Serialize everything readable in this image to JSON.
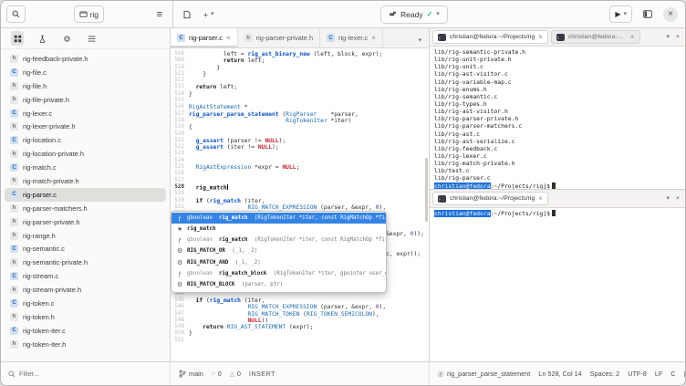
{
  "titlebar": {
    "project_label": "rig",
    "ready_label": "Ready",
    "plus_label": "+"
  },
  "sidebar": {
    "files": [
      {
        "type": "h",
        "name": "rig-feedback-private.h"
      },
      {
        "type": "c",
        "name": "rig-file.c"
      },
      {
        "type": "h",
        "name": "rig-file.h"
      },
      {
        "type": "h",
        "name": "rig-file-private.h"
      },
      {
        "type": "c",
        "name": "rig-lexer.c"
      },
      {
        "type": "h",
        "name": "rig-lexer-private.h"
      },
      {
        "type": "c",
        "name": "rig-location.c"
      },
      {
        "type": "h",
        "name": "rig-location-private.h"
      },
      {
        "type": "c",
        "name": "rig-match.c"
      },
      {
        "type": "h",
        "name": "rig-match-private.h"
      },
      {
        "type": "c",
        "name": "rig-parser.c",
        "selected": true
      },
      {
        "type": "h",
        "name": "rig-parser-matchers.h"
      },
      {
        "type": "h",
        "name": "rig-parser-private.h"
      },
      {
        "type": "h",
        "name": "rig-range.h"
      },
      {
        "type": "c",
        "name": "rig-semantic.c"
      },
      {
        "type": "h",
        "name": "rig-semantic-private.h"
      },
      {
        "type": "c",
        "name": "rig-stream.c"
      },
      {
        "type": "h",
        "name": "rig-stream-private.h"
      },
      {
        "type": "c",
        "name": "rig-token.c"
      },
      {
        "type": "h",
        "name": "rig-token.h"
      },
      {
        "type": "c",
        "name": "rig-token-iter.c"
      },
      {
        "type": "h",
        "name": "rig-token-iter.h"
      }
    ]
  },
  "editor": {
    "tabs": [
      {
        "icon": "c",
        "label": "rig-parser.c",
        "active": true,
        "close": true
      },
      {
        "icon": "h",
        "label": "rig-parser-private.h",
        "active": false,
        "close": false
      },
      {
        "icon": "c",
        "label": "rig-lexer.c",
        "active": false,
        "close": true
      }
    ],
    "cursor_line": 528,
    "lines": [
      {
        "n": 508,
        "t": "          left = rig_ast_binary_new (left, block, expr);"
      },
      {
        "n": 509,
        "t": "          return left;"
      },
      {
        "n": 510,
        "t": "        }"
      },
      {
        "n": 511,
        "t": "    }"
      },
      {
        "n": 512,
        "t": ""
      },
      {
        "n": 513,
        "t": "  return left;"
      },
      {
        "n": 514,
        "t": "}"
      },
      {
        "n": 515,
        "t": ""
      },
      {
        "n": 516,
        "t": "RigAstStatement *"
      },
      {
        "n": 517,
        "t": "rig_parser_parse_statement (RigParser    *parser,"
      },
      {
        "n": 518,
        "t": "                            RigTokenIter *iter)"
      },
      {
        "n": 519,
        "t": "{"
      },
      {
        "n": 520,
        "t": ""
      },
      {
        "n": 521,
        "t": "  g_assert (parser != NULL);"
      },
      {
        "n": 522,
        "t": "  g_assert (iter != NULL);"
      },
      {
        "n": 523,
        "t": ""
      },
      {
        "n": 524,
        "t": ""
      },
      {
        "n": 525,
        "t": "  RigAstExpression *expr = NULL;"
      },
      {
        "n": 526,
        "t": ""
      },
      {
        "n": 527,
        "t": ""
      },
      {
        "n": 528,
        "t": "  rig_match"
      },
      {
        "n": 529,
        "t": ""
      },
      {
        "n": 530,
        "t": "  if (rig_match (iter,"
      },
      {
        "n": 531,
        "t": "                 RIG_MATCH_EXPRESSION (parser, &expr, 0),"
      },
      {
        "n": 532,
        "t": "                 RIG_MATCH_TOKEN (RIG_TOKEN_SEMICOLON),"
      },
      {
        "n": 533,
        "t": "                 NULL))"
      },
      {
        "n": 534,
        "t": "    return RIG_AST_STATEMENT (expr);"
      },
      {
        "n": 535,
        "t": "      if (rig_match (iter, RIG_MATCH_EXPRESSION (parser, &expr, 0));"
      },
      {
        "n": 536,
        "t": ""
      },
      {
        "n": 537,
        "t": ""
      },
      {
        "n": 538,
        "t": "          return rig_ast_statement_new (parser, iter, &loc, expr));"
      },
      {
        "n": 539,
        "t": ""
      },
      {
        "n": 540,
        "t": ""
      },
      {
        "n": 541,
        "t": ""
      },
      {
        "n": 542,
        "t": "  RigAstExpression *expr = NULL;"
      },
      {
        "n": 543,
        "t": ""
      },
      {
        "n": 544,
        "t": ""
      },
      {
        "n": 545,
        "t": "  if (rig_match (iter,"
      },
      {
        "n": 546,
        "t": "                 RIG_MATCH_EXPRESSION (parser, &expr, 0),"
      },
      {
        "n": 547,
        "t": "                 RIG_MATCH_TOKEN (RIG_TOKEN_SEMICOLON),"
      },
      {
        "n": 548,
        "t": "                 NULL))"
      },
      {
        "n": 549,
        "t": "    return RIG_AST_STATEMENT (expr);"
      },
      {
        "n": 550,
        "t": "}"
      },
      {
        "n": 551,
        "t": ""
      }
    ]
  },
  "completion": {
    "rows": [
      {
        "kind": "fn",
        "ret": "gboolean",
        "name": "rig_match",
        "params": " (RigTokenIter *iter, const RigMatchOp *first_op, ...)",
        "selected": true
      },
      {
        "kind": "snippet",
        "ret": "",
        "name": "rig_match",
        "params": ""
      },
      {
        "kind": "fn",
        "ret": "gboolean",
        "name": "rig_match",
        "params": " (RigTokenIter *iter, const RigMatchOp *first_op, ..."
      },
      {
        "kind": "macro",
        "ret": "",
        "name": "RIG_MATCH_OR",
        "params": " (_1, _2)"
      },
      {
        "kind": "macro",
        "ret": "",
        "name": "RIG_MATCH_AND",
        "params": " (_1, _2)"
      },
      {
        "kind": "fn",
        "ret": "gboolean",
        "name": "rig_match_block",
        "params": " (RigTokenIter *iter, gpointer user_data)"
      },
      {
        "kind": "macro",
        "ret": "",
        "name": "RIG_MATCH_BLOCK",
        "params": " (parser, ptr)"
      }
    ]
  },
  "terminals": {
    "prompt_user": "christian@fedora",
    "prompt_rest": ":~/Projects/rig]$",
    "top": {
      "tabs": [
        {
          "label": "christian@fedora:~/Projects/rig",
          "active": true,
          "close": true
        },
        {
          "label": "christian@fedora:~/Projects/rig",
          "active": false,
          "close": true
        }
      ],
      "output": [
        "lib/rig-semantic-private.h",
        "lib/rig-unit-private.h",
        "lib/rig-unit.c",
        "lib/rig-ast-visitor.c",
        "lib/rig-variable-map.c",
        "lib/rig-enums.h",
        "lib/rig-semantic.c",
        "lib/rig-types.h",
        "lib/rig-ast-visitor.h",
        "lib/rig-parser-private.h",
        "lib/rig-parser-matchers.c",
        "lib/rig-ast.c",
        "lib/rig-ast-serialize.c",
        "lib/rig-feedback.c",
        "lib/rig-lexer.c",
        "lib/rig-match-private.h",
        "lib/test.c",
        "lib/rig-parser.c"
      ]
    },
    "bottom": {
      "tabs": [
        {
          "label": "christian@fedora:~/Projects/rig",
          "active": true,
          "close": true
        }
      ],
      "output": []
    }
  },
  "statusbar": {
    "filter_placeholder": "Filter...",
    "branch": "main",
    "errors": "0",
    "warnings": "0",
    "mode": "INSERT",
    "symbol": "rig_parser_parse_statement",
    "position": "Ln 528, Col 14",
    "spaces": "Spaces: 2",
    "encoding": "UTF-8",
    "eol": "LF",
    "language": "C"
  }
}
